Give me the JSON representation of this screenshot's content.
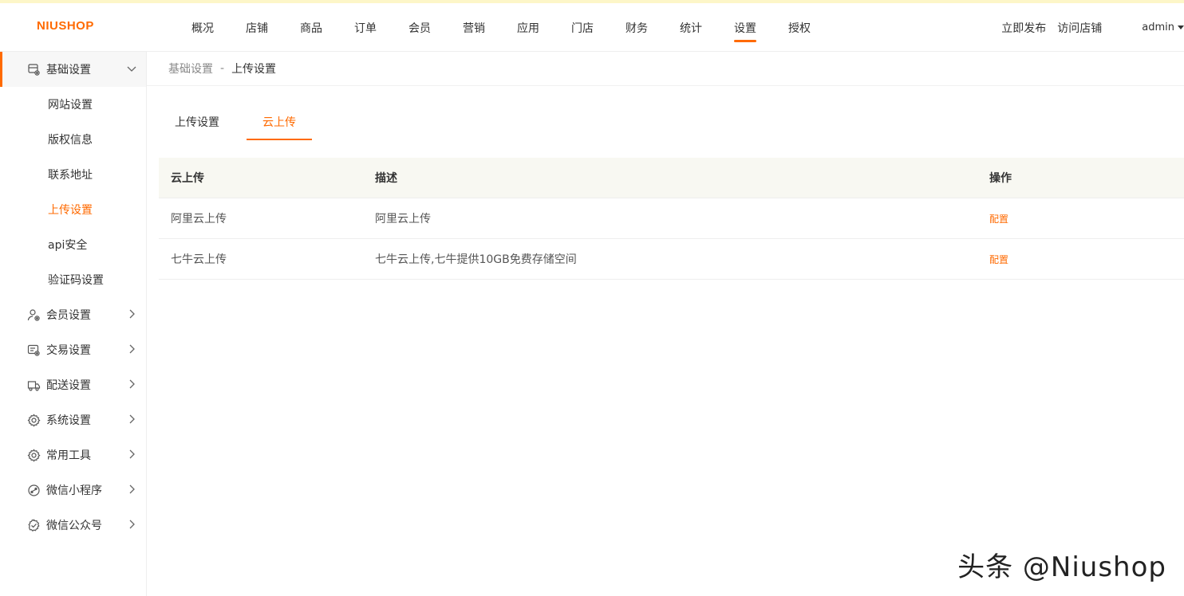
{
  "brand": {
    "logo_text": "NIUSHOP",
    "accent_color": "#ff6a00"
  },
  "top_nav": {
    "items": [
      {
        "label": "概况"
      },
      {
        "label": "店铺"
      },
      {
        "label": "商品"
      },
      {
        "label": "订单"
      },
      {
        "label": "会员"
      },
      {
        "label": "营销"
      },
      {
        "label": "应用"
      },
      {
        "label": "门店"
      },
      {
        "label": "财务"
      },
      {
        "label": "统计"
      },
      {
        "label": "设置",
        "active": true
      },
      {
        "label": "授权"
      }
    ],
    "publish_label": "立即发布",
    "visit_store_label": "访问店铺",
    "user_label": "admin"
  },
  "sidebar": {
    "groups": [
      {
        "label": "基础设置",
        "icon": "basic-settings-icon",
        "expanded": true
      },
      {
        "label": "会员设置",
        "icon": "member-settings-icon"
      },
      {
        "label": "交易设置",
        "icon": "trade-settings-icon"
      },
      {
        "label": "配送设置",
        "icon": "delivery-settings-icon"
      },
      {
        "label": "系统设置",
        "icon": "system-settings-icon"
      },
      {
        "label": "常用工具",
        "icon": "tools-icon"
      },
      {
        "label": "微信小程序",
        "icon": "mini-program-icon"
      },
      {
        "label": "微信公众号",
        "icon": "official-account-icon"
      }
    ],
    "basic_sub_items": [
      {
        "label": "网站设置"
      },
      {
        "label": "版权信息"
      },
      {
        "label": "联系地址"
      },
      {
        "label": "上传设置",
        "active": true
      },
      {
        "label": "api安全"
      },
      {
        "label": "验证码设置"
      }
    ]
  },
  "breadcrumb": {
    "parent": "基础设置",
    "separator": "-",
    "current": "上传设置"
  },
  "tabs": [
    {
      "label": "上传设置"
    },
    {
      "label": "云上传",
      "active": true
    }
  ],
  "table": {
    "headers": [
      "云上传",
      "描述",
      "操作"
    ],
    "rows": [
      {
        "name": "阿里云上传",
        "desc": "阿里云上传",
        "action": "配置"
      },
      {
        "name": "七牛云上传",
        "desc": "七牛云上传,七牛提供10GB免费存储空间",
        "action": "配置"
      }
    ]
  },
  "watermark": "头条 @Niushop"
}
